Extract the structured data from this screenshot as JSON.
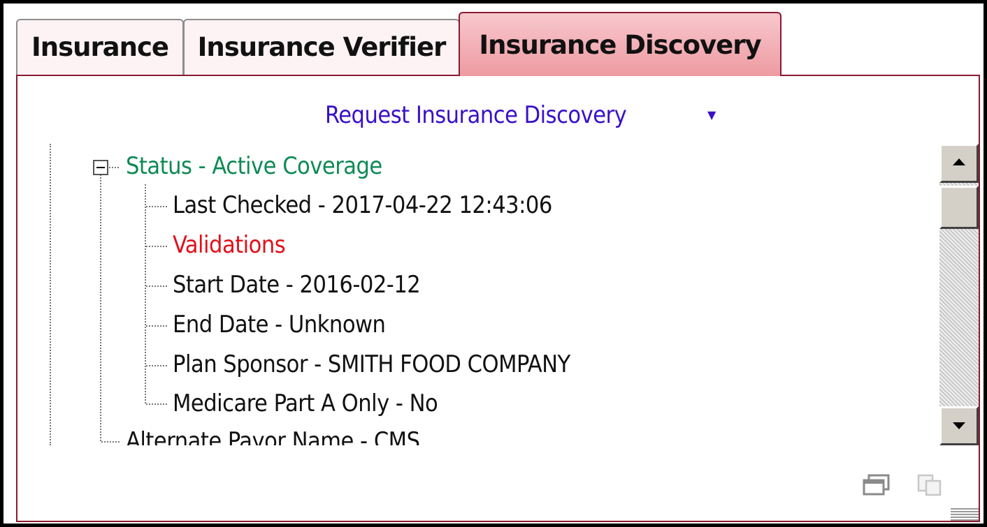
{
  "tabs": [
    {
      "label": "Insurance",
      "active": false
    },
    {
      "label": "Insurance Verifier",
      "active": false
    },
    {
      "label": "Insurance Discovery",
      "active": true
    }
  ],
  "panel": {
    "request_link": "Request Insurance Discovery",
    "request_dropdown_glyph": "▼"
  },
  "tree": {
    "status": {
      "label": "Status - Active Coverage",
      "color": "#0e8a55",
      "expanded": true
    },
    "children": [
      {
        "label": "Last Checked - 2017-04-22 12:43:06",
        "color": "#111111"
      },
      {
        "label": "Validations",
        "color": "#e0101a"
      },
      {
        "label": "Start Date - 2016-02-12",
        "color": "#111111"
      },
      {
        "label": "End Date - Unknown",
        "color": "#111111"
      },
      {
        "label": "Plan Sponsor - SMITH FOOD COMPANY",
        "color": "#111111"
      },
      {
        "label": "Medicare Part A Only - No",
        "color": "#111111"
      }
    ],
    "next_sibling": {
      "label": "Alternate Payor Name - CMS",
      "color": "#111111"
    }
  },
  "icons": {
    "window": "window-icon",
    "copy": "copy-icon",
    "scroll_up": "arrow-up-icon",
    "scroll_down": "arrow-down-icon",
    "expander": "minus-icon"
  },
  "colors": {
    "accent_border": "#8a1a30",
    "active_tab": "#f0a5ad",
    "link": "#3a10c8"
  }
}
